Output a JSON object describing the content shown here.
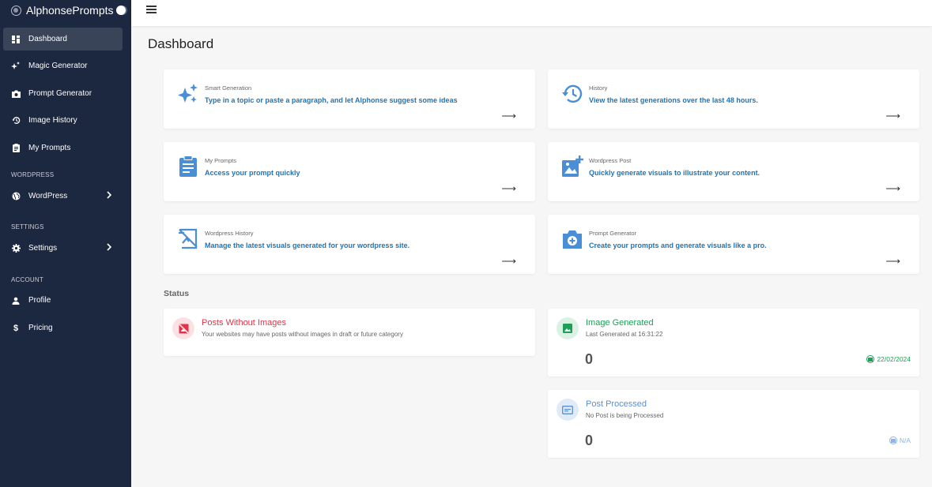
{
  "app": {
    "name": "AlphonsePrompts"
  },
  "sidebar": {
    "items": [
      {
        "label": "Dashboard",
        "icon": "dashboard-icon"
      },
      {
        "label": "Magic Generator",
        "icon": "sparkle-icon"
      },
      {
        "label": "Prompt Generator",
        "icon": "camera-icon"
      },
      {
        "label": "Image History",
        "icon": "history-icon"
      },
      {
        "label": "My Prompts",
        "icon": "clipboard-icon"
      }
    ],
    "sections": [
      {
        "label": "WORDPRESS",
        "item": {
          "label": "WordPress",
          "icon": "globe-icon"
        }
      },
      {
        "label": "SETTINGS",
        "item": {
          "label": "Settings",
          "icon": "gear-icon"
        }
      },
      {
        "label": "ACCOUNT",
        "items": [
          {
            "label": "Profile",
            "icon": "user-icon"
          },
          {
            "label": "Pricing",
            "icon": "dollar-icon"
          }
        ]
      }
    ]
  },
  "page": {
    "title": "Dashboard"
  },
  "cards": [
    {
      "kicker": "Smart Generation",
      "desc": "Type in a topic or paste a paragraph, and let Alphonse suggest some ideas",
      "icon": "sparkle-icon"
    },
    {
      "kicker": "History",
      "desc": "View the latest generations over the last 48 hours.",
      "icon": "history-icon"
    },
    {
      "kicker": "My Prompts",
      "desc": "Access your prompt quickly",
      "icon": "clipboard-icon"
    },
    {
      "kicker": "Wordpress Post",
      "desc": "Quickly generate visuals to illustrate your content.",
      "icon": "add-image-icon"
    },
    {
      "kicker": "Wordpress History",
      "desc": "Manage the latest visuals generated for your wordpress site.",
      "icon": "wordpress-history-icon"
    },
    {
      "kicker": "Prompt Generator",
      "desc": "Create your prompts and generate visuals like a pro.",
      "icon": "add-photo-icon"
    }
  ],
  "arrow": "⟶",
  "status": {
    "label": "Status",
    "posts_without_images": {
      "title": "Posts Without Images",
      "subtitle": "Your websites may have posts without images in draft or future category",
      "color": "#e0344a"
    },
    "image_generated": {
      "title": "Image Generated",
      "subtitle": "Last Generated at 16:31:22",
      "value": "0",
      "date": "22/02/2024",
      "color": "#1e9e57"
    },
    "post_processed": {
      "title": "Post Processed",
      "subtitle": "No Post is being Processed",
      "value": "0",
      "meta": "N/A",
      "color": "#5b8fcf"
    }
  }
}
